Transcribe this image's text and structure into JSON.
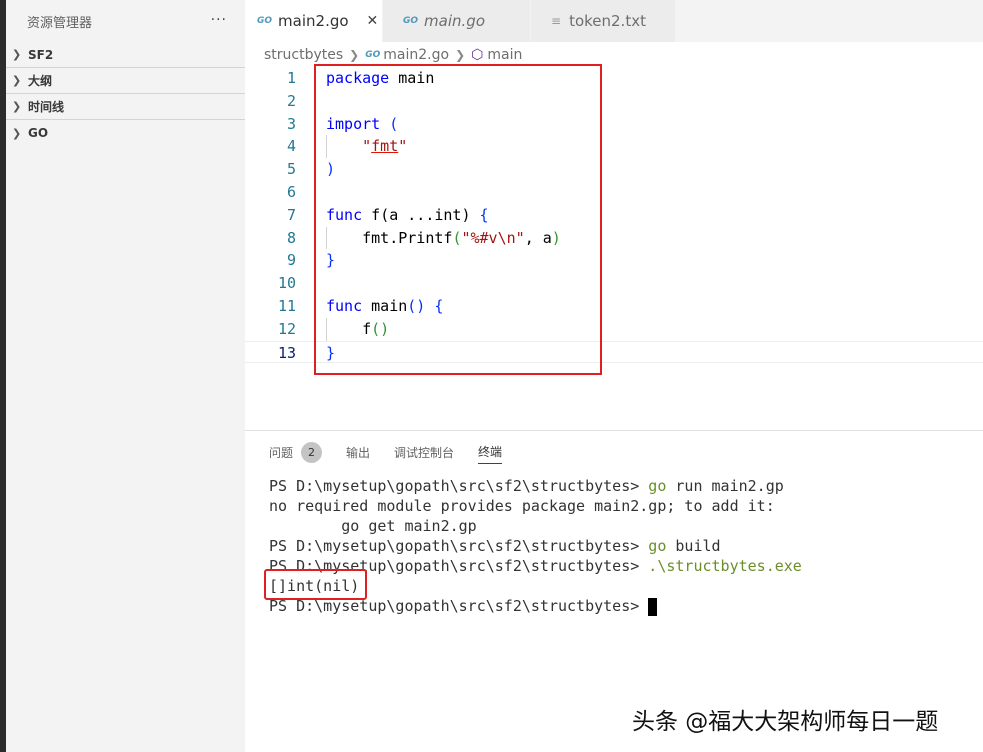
{
  "sidebar": {
    "title": "资源管理器",
    "more_icon": "···",
    "sections": [
      "SF2",
      "大纲",
      "时间线",
      "GO"
    ]
  },
  "tabs": [
    {
      "label": "main2.go",
      "icon": "go-file-icon",
      "active": true,
      "close": "✕"
    },
    {
      "label": "main.go",
      "icon": "go-file-icon",
      "active": false
    },
    {
      "label": "token2.txt",
      "icon": "text-file-icon",
      "active": false
    }
  ],
  "breadcrumb": {
    "folder": "structbytes",
    "file": "main2.go",
    "symbol": "main"
  },
  "code": {
    "line_numbers": [
      "1",
      "2",
      "3",
      "4",
      "5",
      "6",
      "7",
      "8",
      "9",
      "10",
      "11",
      "12",
      "13"
    ],
    "l1_kw": "package",
    "l1_rest": " main",
    "l3_kw": "import",
    "l3_paren": " (",
    "l4_q1": "    \"",
    "l4_fmt": "fmt",
    "l4_q2": "\"",
    "l5_paren": ")",
    "l7_kw": "func",
    "l7_rest": " f",
    "l7_p1": "(",
    "l7_mid": "a ...int",
    "l7_p2": ")",
    "l7_brace": " {",
    "l8_pre": "    fmt.Printf",
    "l8_p1": "(",
    "l8_str": "\"%#v\\n\"",
    "l8_post": ", a",
    "l8_p2": ")",
    "l9_brace": "}",
    "l11_kw": "func",
    "l11_rest": " main",
    "l11_parens": "()",
    "l11_brace": " {",
    "l12_pre": "    f",
    "l12_parens": "()",
    "l13_brace": "}"
  },
  "panel": {
    "tabs": [
      "问题",
      "输出",
      "调试控制台",
      "终端"
    ],
    "problems_count": "2",
    "active_tab": "终端"
  },
  "terminal": {
    "prompt": "PS D:\\mysetup\\gopath\\src\\sf2\\structbytes> ",
    "cmd1_word": "go",
    "cmd1_rest": " run main2.gp",
    "err1": "no required module provides package main2.gp; to add it:",
    "err2": "        go get main2.gp",
    "cmd2_word": "go",
    "cmd2_rest": " build",
    "cmd3": ".\\structbytes.exe",
    "output": "[]int(nil)"
  },
  "watermark": "头条 @福大大架构师每日一题",
  "colors": {
    "highlight_box": "#e02020",
    "keyword": "#0000ff",
    "string": "#a31515"
  }
}
